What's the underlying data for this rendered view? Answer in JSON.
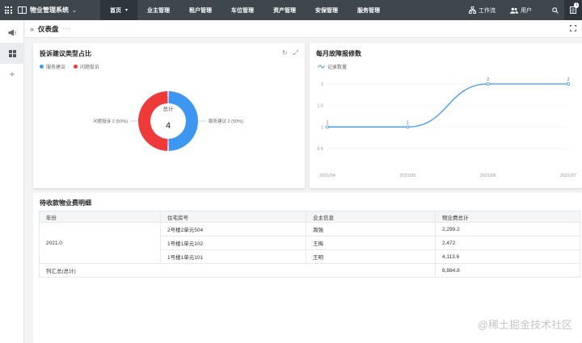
{
  "app": {
    "title": "物业管理系统"
  },
  "nav": [
    {
      "label": "首页",
      "active": true,
      "has_dropdown": true
    },
    {
      "label": "业主管理"
    },
    {
      "label": "租户管理"
    },
    {
      "label": "车位管理"
    },
    {
      "label": "资产管理"
    },
    {
      "label": "安保管理"
    },
    {
      "label": "服务管理"
    }
  ],
  "header_tools": {
    "workflow_label": "工作流",
    "user_label": "用户",
    "notification_count": "1"
  },
  "page": {
    "title": "仪表盘",
    "more": "···"
  },
  "donut_card": {
    "title": "投诉建议类型占比",
    "legend": [
      "服务建议",
      "问题投诉"
    ],
    "center_label": "总计",
    "center_value": "4",
    "left_label": "问题投诉  2 (50%)",
    "right_label": "服务建议  2 (50%)"
  },
  "line_card": {
    "title": "每月故障报修数",
    "legend": "记录数量"
  },
  "chart_data": [
    {
      "type": "pie",
      "title": "投诉建议类型占比",
      "labels": [
        "服务建议",
        "问题投诉"
      ],
      "values": [
        2,
        2
      ],
      "colors": [
        "#3d97f1",
        "#ef3a3a"
      ],
      "total": 4
    },
    {
      "type": "line",
      "title": "每月故障报修数",
      "x": [
        "2021/04",
        "2021/05",
        "2021/06",
        "2021/07"
      ],
      "series": [
        {
          "name": "记录数量",
          "values": [
            1,
            1,
            2,
            2
          ],
          "color": "#3d97f1"
        }
      ],
      "yticks": [
        "0.5",
        "1",
        "1.5",
        "2"
      ],
      "ylim": [
        0.5,
        2
      ]
    }
  ],
  "table": {
    "title": "待收款物业费明细",
    "headers": [
      "年份",
      "住宅房号",
      "业主信息",
      "物业费总计"
    ],
    "year": "2021.0",
    "rows": [
      [
        "2号楼2单元504",
        "周强",
        "2,299.2"
      ],
      [
        "1号楼1单元102",
        "王梅",
        "2,472"
      ],
      [
        "1号楼1单元101",
        "王明",
        "4,113.6"
      ]
    ],
    "footer": [
      "列汇总(总计)",
      "8,884.8"
    ]
  },
  "watermark": "@稀土掘金技术社区"
}
